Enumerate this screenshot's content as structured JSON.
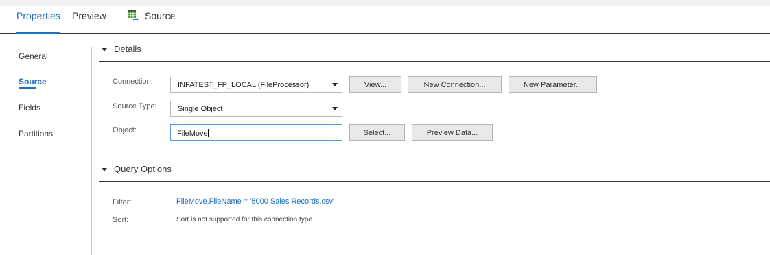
{
  "tabs": {
    "properties": "Properties",
    "preview": "Preview",
    "source": "Source"
  },
  "leftnav": {
    "items": [
      "General",
      "Source",
      "Fields",
      "Partitions"
    ],
    "active": "Source"
  },
  "details": {
    "title": "Details",
    "connection_label": "Connection:",
    "connection_value": "INFATEST_FP_LOCAL (FileProcessor)",
    "view_button": "View...",
    "new_connection_button": "New Connection...",
    "new_parameter_button": "New Parameter...",
    "source_type_label": "Source Type:",
    "source_type_value": "Single Object",
    "object_label": "Object:",
    "object_value": "FileMove",
    "select_button": "Select...",
    "preview_data_button": "Preview Data..."
  },
  "query_options": {
    "title": "Query Options",
    "filter_label": "Filter:",
    "filter_value": "FileMove.FileName = '5000 Sales Records.csv'",
    "sort_label": "Sort:",
    "sort_value": "Sort is not supported for this connection type."
  },
  "colors": {
    "accent": "#1f6fc1",
    "input_focus_border": "#5b9bd5",
    "button_bg": "#e9e9e9"
  },
  "icons": {
    "source": "table-arrow-icon",
    "section_caret": "caret-down-icon",
    "dropdown": "dropdown-arrow-icon"
  }
}
